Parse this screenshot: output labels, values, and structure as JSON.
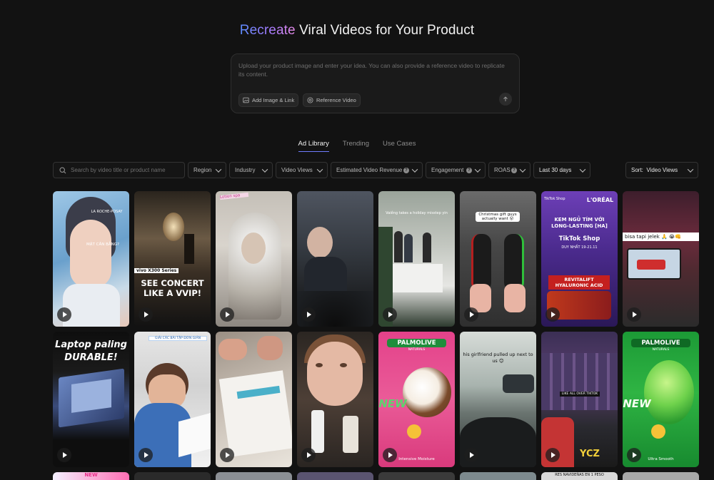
{
  "hero": {
    "title_highlight": "Recreate",
    "title_rest": " Viral Videos for Your Product"
  },
  "prompt": {
    "placeholder": "Upload your product image and enter your idea. You can also provide a reference video to replicate its content.",
    "add_image_label": "Add Image & Link",
    "reference_video_label": "Reference Video",
    "send_icon": "arrow-up-icon"
  },
  "tabs": [
    {
      "label": "Ad Library",
      "active": true
    },
    {
      "label": "Trending",
      "active": false
    },
    {
      "label": "Use Cases",
      "active": false
    }
  ],
  "filters": {
    "search_placeholder": "Search by video title or product name",
    "region": "Region",
    "industry": "Industry",
    "video_views": "Video Views",
    "estimated_revenue": "Estimated Video Revenue",
    "engagement": "Engagement",
    "roas": "ROAS",
    "date_range": "Last 30 days",
    "sort_label": "Sort:",
    "sort_value": "Video Views"
  },
  "colors": {
    "accent": "#6f7cff",
    "background": "#121212"
  },
  "videos": [
    {
      "overlay": "MẶT CÂN BẰNG?",
      "brand": "LA ROCHE-POSAY"
    },
    {
      "overlay": "SEE CONCERT LIKE A VVIP!",
      "tag": "vivo X300 Series"
    },
    {
      "overlay": "Lotion spa"
    },
    {
      "overlay": ""
    },
    {
      "overlay": "Vaiềng takes a holiday misstep yin"
    },
    {
      "overlay": "Christmas gift guys actually want 😮"
    },
    {
      "overlay": "KEM NGỦ TÍM VỚI LONG-LASTING [HA]",
      "brand": "L'ORÉAL",
      "shop": "TikTok Shop",
      "date": "DUY NHẤT 19-21.11",
      "product": "REVITALIFT HYALURONIC ACID"
    },
    {
      "overlay": "bisa tapi jelek 🙏 😭👊"
    },
    {
      "overlay": "Laptop paling DURABLE!"
    },
    {
      "overlay": "GIẢI CÁC BÀI TẬP ĐƠN GIẢN"
    },
    {
      "overlay": ""
    },
    {
      "overlay": ""
    },
    {
      "overlay": "NEW",
      "brand": "PALMOLIVE",
      "sub": "NATURALS",
      "product": "Intensive Moisture"
    },
    {
      "overlay": "his girlfriend pulled up next to us 😊"
    },
    {
      "overlay": "LIKE ALL OVER TIKTOK",
      "tag": "YCZ"
    },
    {
      "overlay": "NEW",
      "brand": "PALMOLIVE",
      "sub": "NATURALS",
      "product": "Ultra Smooth"
    }
  ],
  "row3_partial": [
    "NEW",
    "",
    "",
    "",
    "",
    "",
    "RES NAVIDEÑAS EN 1 PESO",
    ""
  ]
}
